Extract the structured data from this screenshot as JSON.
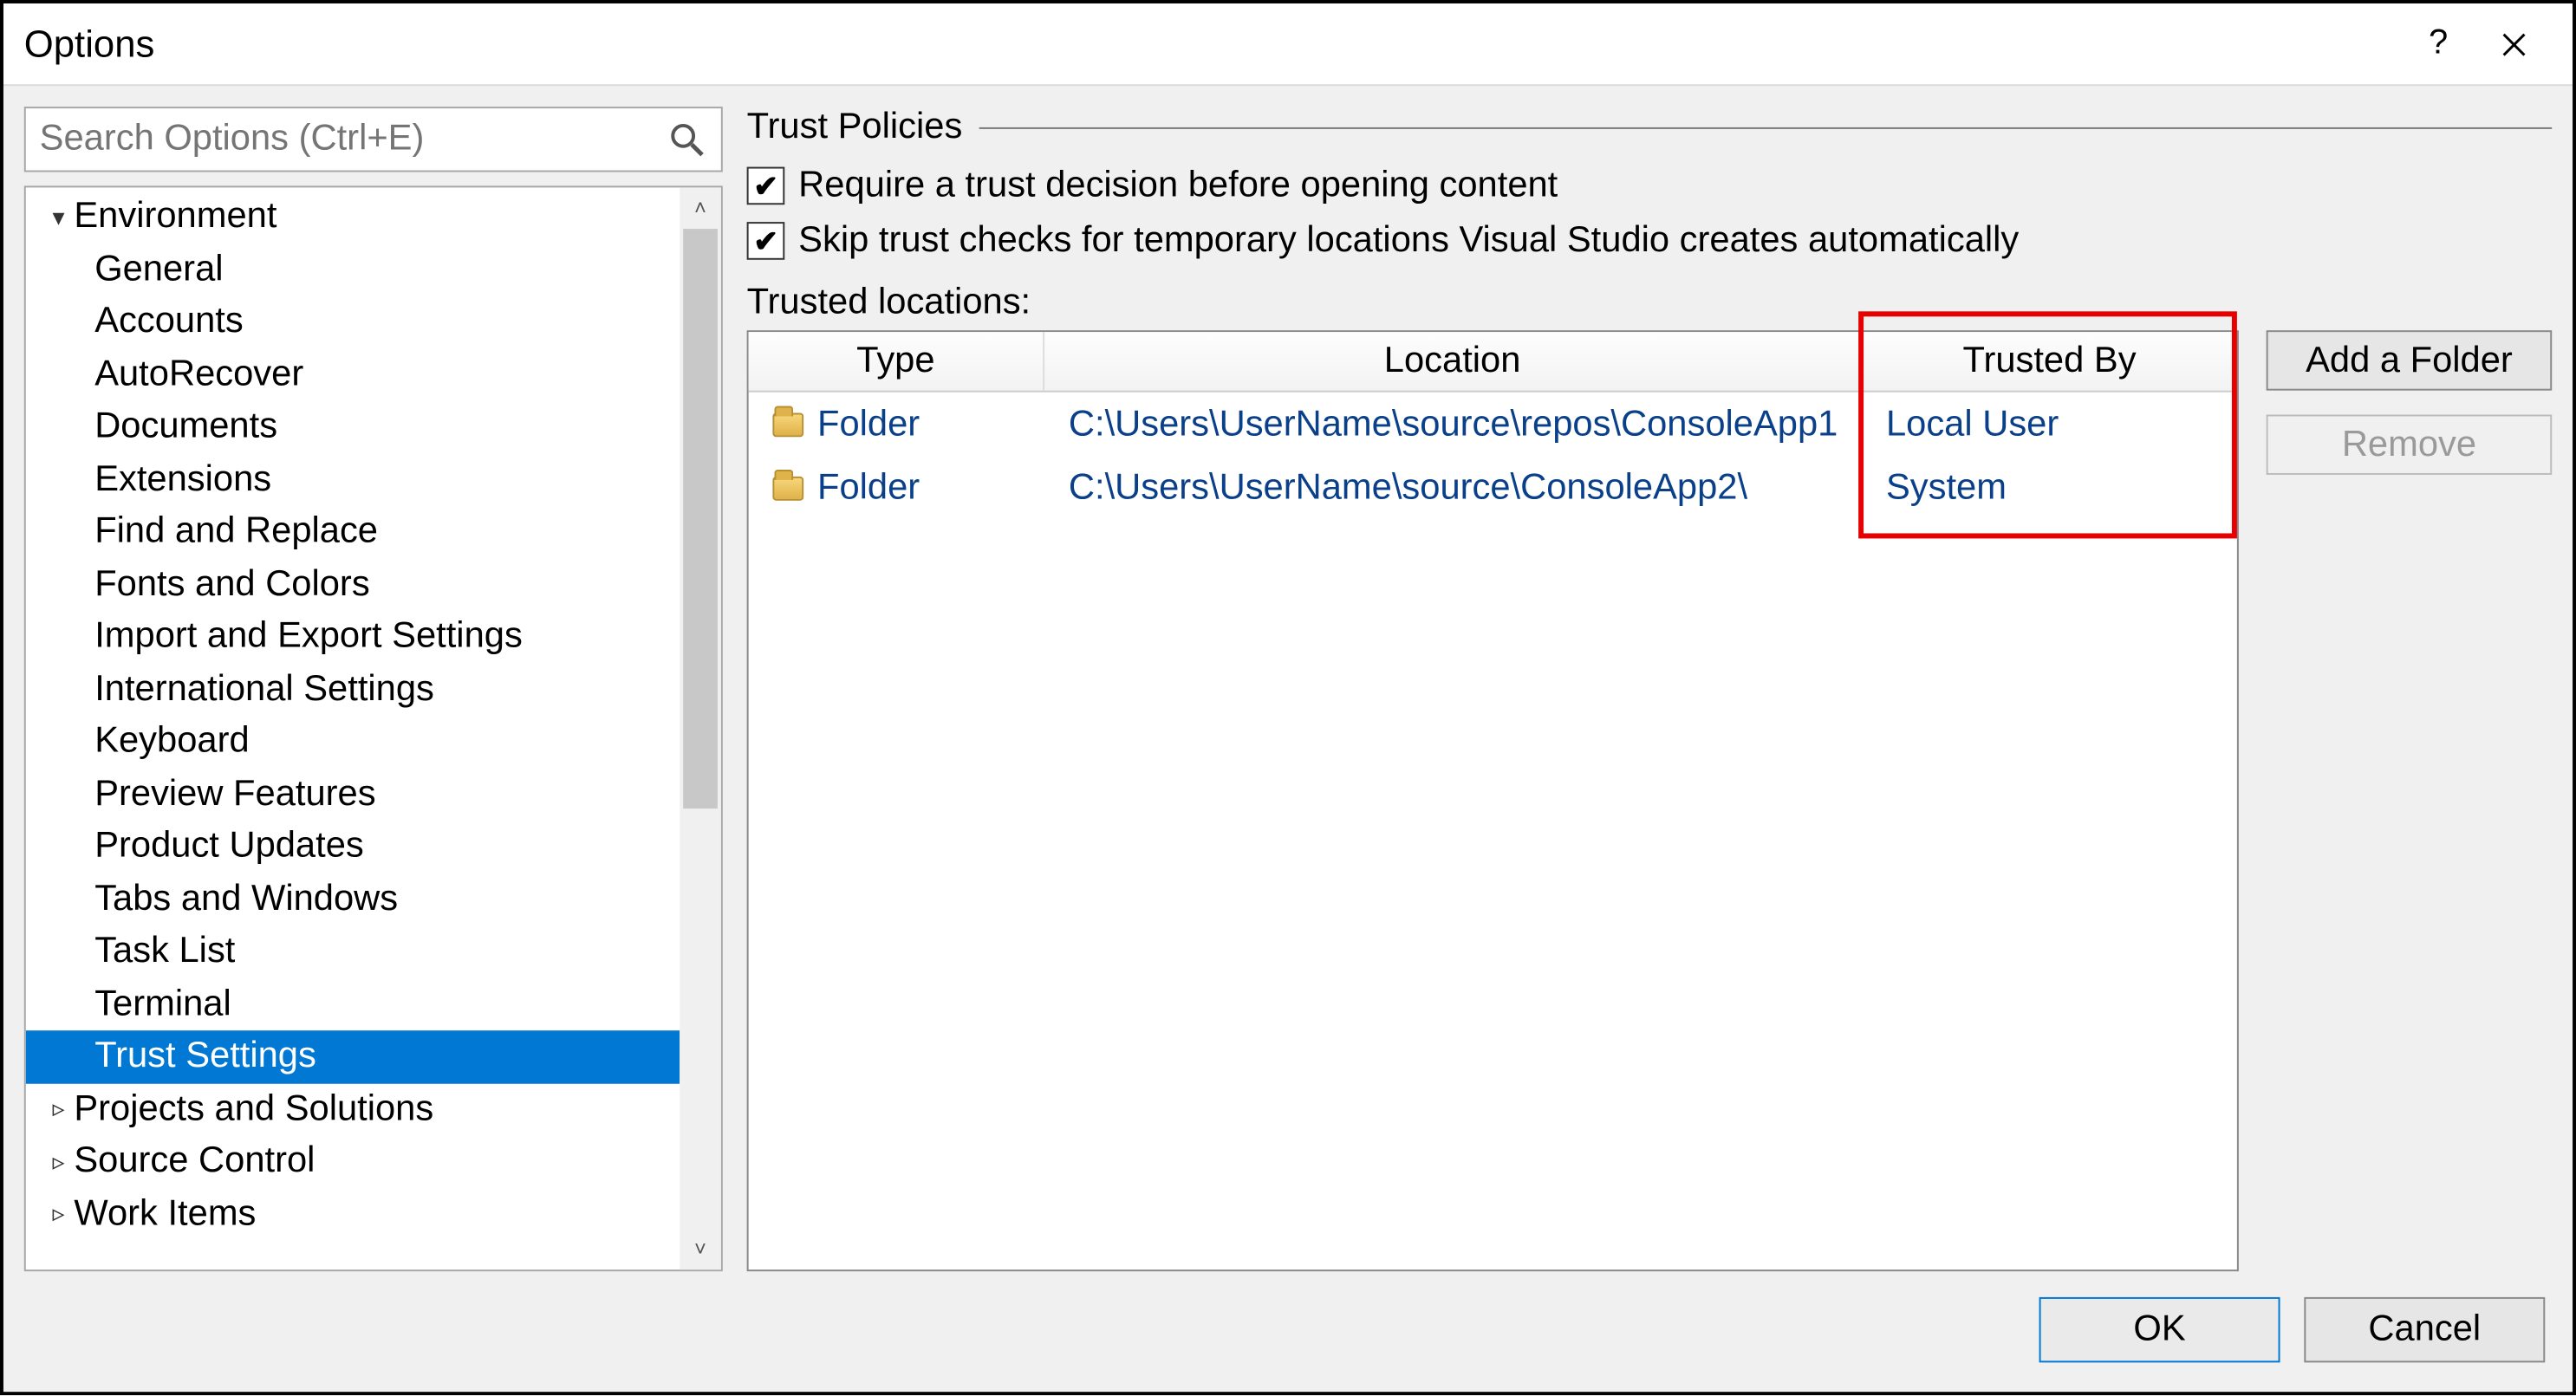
{
  "window": {
    "title": "Options"
  },
  "search": {
    "placeholder": "Search Options (Ctrl+E)"
  },
  "tree": {
    "nodes": [
      {
        "label": "Environment",
        "expand": "▾",
        "level": 0
      },
      {
        "label": "General",
        "level": 1
      },
      {
        "label": "Accounts",
        "level": 1
      },
      {
        "label": "AutoRecover",
        "level": 1
      },
      {
        "label": "Documents",
        "level": 1
      },
      {
        "label": "Extensions",
        "level": 1
      },
      {
        "label": "Find and Replace",
        "level": 1
      },
      {
        "label": "Fonts and Colors",
        "level": 1
      },
      {
        "label": "Import and Export Settings",
        "level": 1
      },
      {
        "label": "International Settings",
        "level": 1
      },
      {
        "label": "Keyboard",
        "level": 1
      },
      {
        "label": "Preview Features",
        "level": 1
      },
      {
        "label": "Product Updates",
        "level": 1
      },
      {
        "label": "Tabs and Windows",
        "level": 1
      },
      {
        "label": "Task List",
        "level": 1
      },
      {
        "label": "Terminal",
        "level": 1
      },
      {
        "label": "Trust Settings",
        "level": 1,
        "selected": true
      },
      {
        "label": "Projects and Solutions",
        "expand": "▹",
        "level": 0
      },
      {
        "label": "Source Control",
        "expand": "▹",
        "level": 0
      },
      {
        "label": "Work Items",
        "expand": "▹",
        "level": 0
      }
    ]
  },
  "panel": {
    "group_title": "Trust Policies",
    "check1": "Require a trust decision before opening content",
    "check2": "Skip trust checks for temporary locations Visual Studio creates automatically",
    "trusted_locations_label": "Trusted locations:",
    "columns": {
      "type": "Type",
      "location": "Location",
      "trusted_by": "Trusted By"
    },
    "rows": [
      {
        "type": "Folder",
        "location": "C:\\Users\\UserName\\source\\repos\\ConsoleApp1",
        "trusted_by": "Local User"
      },
      {
        "type": "Folder",
        "location": "C:\\Users\\UserName\\source\\ConsoleApp2\\",
        "trusted_by": "System"
      }
    ],
    "add_button": "Add a Folder",
    "remove_button": "Remove"
  },
  "footer": {
    "ok": "OK",
    "cancel": "Cancel"
  }
}
